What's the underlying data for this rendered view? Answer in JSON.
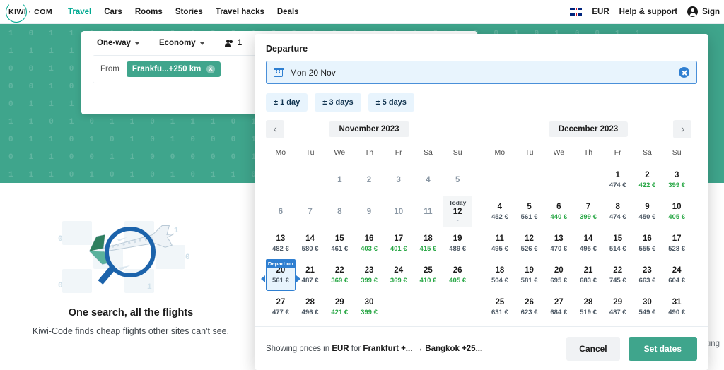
{
  "header": {
    "logo": "KIWI · COM",
    "nav": [
      {
        "label": "Travel",
        "active": true
      },
      {
        "label": "Cars",
        "active": false
      },
      {
        "label": "Rooms",
        "active": false
      },
      {
        "label": "Stories",
        "active": false
      },
      {
        "label": "Travel hacks",
        "active": false
      },
      {
        "label": "Deals",
        "active": false
      }
    ],
    "currency": "EUR",
    "help": "Help & support",
    "sign": "Sign"
  },
  "search_form": {
    "trip_type": "One-way",
    "cabin_class": "Economy",
    "passengers": "1",
    "from_label": "From",
    "from_tag": "Frankfu...+250 km"
  },
  "promo": {
    "title": "One search, all the flights",
    "subtitle": "Kiwi-Code finds cheap flights other sites can't see.",
    "booking_ghost": "ooking"
  },
  "date_picker": {
    "title": "Departure",
    "input_value": "Mon 20 Nov",
    "flex_chips": [
      "± 1 day",
      "± 3 days",
      "± 5 days"
    ],
    "weekdays": [
      "Mo",
      "Tu",
      "We",
      "Th",
      "Fr",
      "Sa",
      "Su"
    ],
    "today_label": "Today",
    "today_dash": "-",
    "depart_badge": "Depart on",
    "footer_prefix": "Showing prices in ",
    "footer_currency": "EUR",
    "footer_mid": " for ",
    "footer_origin": "Frankfurt +...",
    "footer_arrow": " → ",
    "footer_destination": "Bangkok +25...",
    "cancel_label": "Cancel",
    "confirm_label": "Set dates",
    "months": [
      {
        "name": "November 2023",
        "lead_blanks": 2,
        "days": [
          {
            "d": "1",
            "price": null,
            "state": "past"
          },
          {
            "d": "2",
            "price": null,
            "state": "past"
          },
          {
            "d": "3",
            "price": null,
            "state": "past"
          },
          {
            "d": "4",
            "price": null,
            "state": "past"
          },
          {
            "d": "5",
            "price": null,
            "state": "past"
          },
          {
            "d": "6",
            "price": null,
            "state": "past"
          },
          {
            "d": "7",
            "price": null,
            "state": "past"
          },
          {
            "d": "8",
            "price": null,
            "state": "past"
          },
          {
            "d": "9",
            "price": null,
            "state": "past"
          },
          {
            "d": "10",
            "price": null,
            "state": "past"
          },
          {
            "d": "11",
            "price": null,
            "state": "past"
          },
          {
            "d": "12",
            "price": null,
            "state": "today"
          },
          {
            "d": "13",
            "price": "482 €",
            "state": "normal"
          },
          {
            "d": "14",
            "price": "580 €",
            "state": "normal"
          },
          {
            "d": "15",
            "price": "461 €",
            "state": "normal"
          },
          {
            "d": "16",
            "price": "403 €",
            "state": "cheap"
          },
          {
            "d": "17",
            "price": "401 €",
            "state": "cheap"
          },
          {
            "d": "18",
            "price": "415 €",
            "state": "cheap"
          },
          {
            "d": "19",
            "price": "489 €",
            "state": "normal"
          },
          {
            "d": "20",
            "price": "561 €",
            "state": "selected"
          },
          {
            "d": "21",
            "price": "487 €",
            "state": "normal"
          },
          {
            "d": "22",
            "price": "369 €",
            "state": "cheap"
          },
          {
            "d": "23",
            "price": "399 €",
            "state": "cheap"
          },
          {
            "d": "24",
            "price": "369 €",
            "state": "cheap"
          },
          {
            "d": "25",
            "price": "410 €",
            "state": "cheap"
          },
          {
            "d": "26",
            "price": "405 €",
            "state": "cheap"
          },
          {
            "d": "27",
            "price": "477 €",
            "state": "normal"
          },
          {
            "d": "28",
            "price": "496 €",
            "state": "normal"
          },
          {
            "d": "29",
            "price": "421 €",
            "state": "cheap"
          },
          {
            "d": "30",
            "price": "399 €",
            "state": "cheap"
          }
        ]
      },
      {
        "name": "December 2023",
        "lead_blanks": 4,
        "days": [
          {
            "d": "1",
            "price": "474 €",
            "state": "normal"
          },
          {
            "d": "2",
            "price": "422 €",
            "state": "cheap"
          },
          {
            "d": "3",
            "price": "399 €",
            "state": "cheap"
          },
          {
            "d": "4",
            "price": "452 €",
            "state": "normal"
          },
          {
            "d": "5",
            "price": "561 €",
            "state": "normal"
          },
          {
            "d": "6",
            "price": "440 €",
            "state": "cheap"
          },
          {
            "d": "7",
            "price": "399 €",
            "state": "cheap"
          },
          {
            "d": "8",
            "price": "474 €",
            "state": "normal"
          },
          {
            "d": "9",
            "price": "450 €",
            "state": "normal"
          },
          {
            "d": "10",
            "price": "405 €",
            "state": "cheap"
          },
          {
            "d": "11",
            "price": "495 €",
            "state": "normal"
          },
          {
            "d": "12",
            "price": "526 €",
            "state": "normal"
          },
          {
            "d": "13",
            "price": "470 €",
            "state": "normal"
          },
          {
            "d": "14",
            "price": "495 €",
            "state": "normal"
          },
          {
            "d": "15",
            "price": "514 €",
            "state": "normal"
          },
          {
            "d": "16",
            "price": "555 €",
            "state": "normal"
          },
          {
            "d": "17",
            "price": "528 €",
            "state": "normal"
          },
          {
            "d": "18",
            "price": "504 €",
            "state": "normal"
          },
          {
            "d": "19",
            "price": "581 €",
            "state": "normal"
          },
          {
            "d": "20",
            "price": "695 €",
            "state": "normal"
          },
          {
            "d": "21",
            "price": "683 €",
            "state": "normal"
          },
          {
            "d": "22",
            "price": "745 €",
            "state": "normal"
          },
          {
            "d": "23",
            "price": "663 €",
            "state": "normal"
          },
          {
            "d": "24",
            "price": "604 €",
            "state": "normal"
          },
          {
            "d": "25",
            "price": "631 €",
            "state": "normal"
          },
          {
            "d": "26",
            "price": "623 €",
            "state": "normal"
          },
          {
            "d": "27",
            "price": "684 €",
            "state": "normal"
          },
          {
            "d": "28",
            "price": "519 €",
            "state": "normal"
          },
          {
            "d": "29",
            "price": "487 €",
            "state": "normal"
          },
          {
            "d": "30",
            "price": "549 €",
            "state": "normal"
          },
          {
            "d": "31",
            "price": "490 €",
            "state": "normal"
          }
        ]
      }
    ]
  },
  "colors": {
    "brand_green": "#3fa58c",
    "link_green": "#00a991",
    "accent_blue": "#2f7fd1",
    "cheap_green": "#28a745"
  }
}
